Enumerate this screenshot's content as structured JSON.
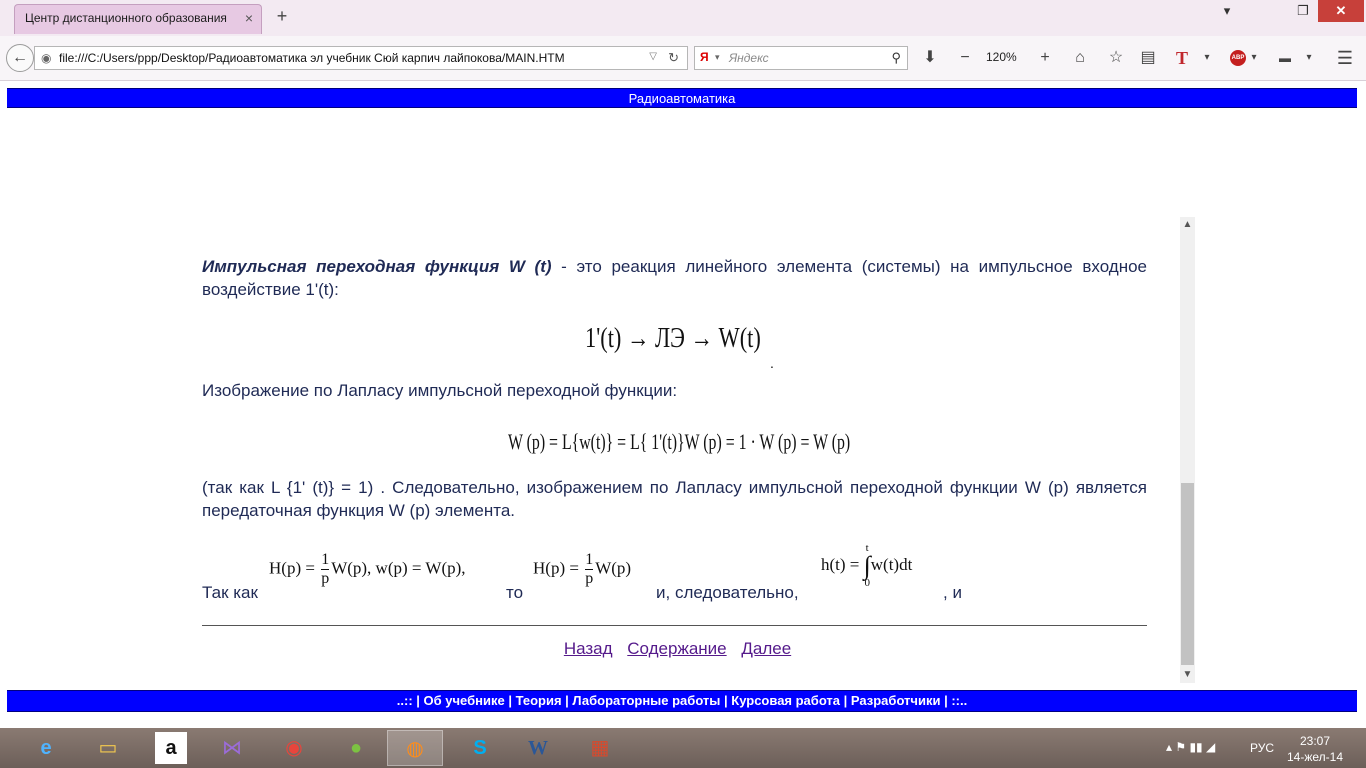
{
  "browser": {
    "tab_title": "Центр дистанционного образования",
    "tab_close": "×",
    "new_tab": "+",
    "win_min": "▾",
    "win_max": "❐",
    "win_close": "✕",
    "url": "file:///C:/Users/ppp/Desktop/Радиоавтоматика эл учебник Сюй карпич лайпокова/MAIN.HTM",
    "search_placeholder": "Яндекс",
    "search_engine_glyph": "Я",
    "zoom": "120%"
  },
  "page": {
    "header_title": "Радиоавтоматика",
    "term": "Импульсная переходная функция W (t)",
    "para1_rest": " - это реакция линейного элемента (системы) на импульсное входное воздействие 1'(t):",
    "formula_chain": "1'(t) → ЛЭ → W(t)",
    "chain_dot": ".",
    "para2": "Изображение по Лапласу импульсной переходной функции:",
    "formula_laplace": "W (p) = L{w(t)} = L{ 1'(t)}W (p) = 1 · W (p) = W (p)",
    "para3": "(так как L {1' (t)} = 1) . Следовательно, изображением по Лапласу импульсной переходной функции W (p) является передаточная функция W (p) элемента.",
    "tak_kak": "Так как",
    "to": "то",
    "sled": "и, следовательно,",
    "i": ", и",
    "f1_left": "H(p) = ",
    "f1_num": "1",
    "f1_den": "p",
    "f1_right": "W(p), w(p) = W(p),",
    "f2_left": "H(p) = ",
    "f2_num": "1",
    "f2_den": "p",
    "f2_right": "W(p)",
    "f3_left": "h(t) = ",
    "f3_upper": "t",
    "f3_int": "∫",
    "f3_lower": "0",
    "f3_right": "w(t)dt",
    "nav_back": "Назад",
    "nav_contents": "Содержание",
    "nav_next": "Далее",
    "footer": "..:: | Об учебнике | Теория | Лабораторные работы | Курсовая работа | Разработчики | ::.."
  },
  "taskbar": {
    "lang": "РУС",
    "time": "23:07",
    "date": "14-жел-14"
  },
  "colors": {
    "bar_blue": "#0000ff",
    "text_navy": "#1f2a55",
    "link_visited": "#551a8b",
    "tab_pink": "#e7c9e3"
  }
}
